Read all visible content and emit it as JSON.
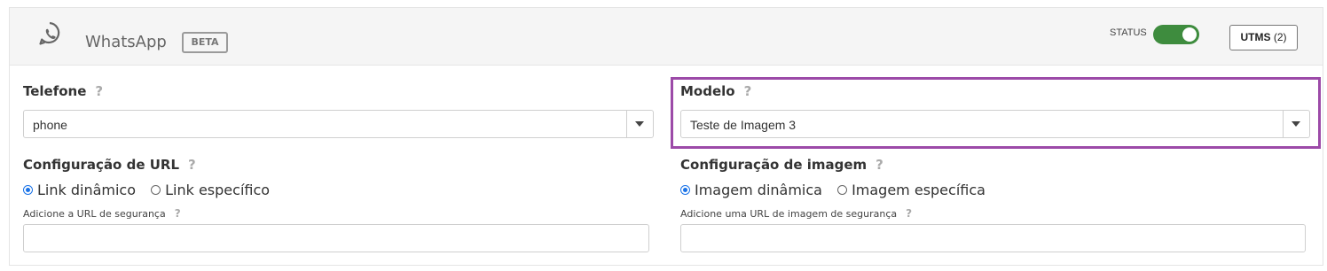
{
  "header": {
    "icon": "whatsapp-icon",
    "title": "WhatsApp",
    "badge": "BETA",
    "status_label": "STATUS",
    "status_on": true,
    "utms_label": "UTMS",
    "utms_count": "(2)",
    "toggle_color": "#3e8c3e"
  },
  "left": {
    "phone_label": "Telefone",
    "phone_value": "phone",
    "url_config_label": "Configuração de URL",
    "radio_dynamic": "Link dinâmico",
    "radio_specific": "Link específico",
    "radio_selected": "dynamic",
    "fallback_label": "Adicione a URL de segurança",
    "fallback_value": ""
  },
  "right": {
    "model_label": "Modelo",
    "model_value": "Teste de Imagem 3",
    "image_config_label": "Configuração de imagem",
    "radio_dynamic": "Imagem dinâmica",
    "radio_specific": "Imagem específica",
    "radio_selected": "dynamic",
    "fallback_label": "Adicione uma URL de imagem de segurança",
    "fallback_value": "",
    "highlight_color": "#9c4aa8"
  },
  "help_symbol": "?"
}
